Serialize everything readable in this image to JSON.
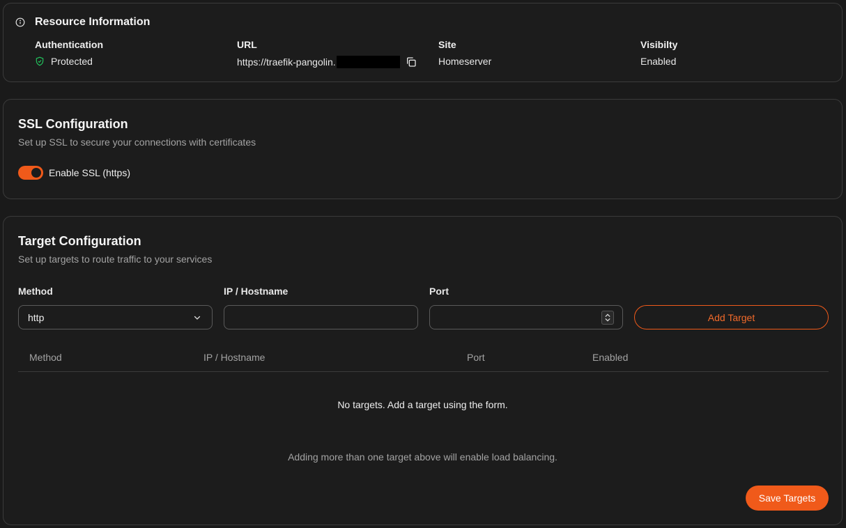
{
  "resource_info": {
    "title": "Resource Information",
    "authentication": {
      "label": "Authentication",
      "value": "Protected"
    },
    "url": {
      "label": "URL",
      "value": "https://traefik-pangolin."
    },
    "site": {
      "label": "Site",
      "value": "Homeserver"
    },
    "visibility": {
      "label": "Visibilty",
      "value": "Enabled"
    }
  },
  "ssl": {
    "title": "SSL Configuration",
    "subtitle": "Set up SSL to secure your connections with certificates",
    "toggle_label": "Enable SSL (https)",
    "enabled": true
  },
  "targets": {
    "title": "Target Configuration",
    "subtitle": "Set up targets to route traffic to your services",
    "form": {
      "method_label": "Method",
      "method_value": "http",
      "ip_label": "IP / Hostname",
      "ip_value": "",
      "port_label": "Port",
      "port_value": "",
      "add_button": "Add Target"
    },
    "table": {
      "columns": [
        "Method",
        "IP / Hostname",
        "Port",
        "Enabled"
      ],
      "empty_message": "No targets. Add a target using the form."
    },
    "load_balancing_note": "Adding more than one target above will enable load balancing.",
    "save_button": "Save Targets"
  },
  "colors": {
    "accent": "#f05a1a",
    "success": "#22c55e",
    "background": "#1a1a1a"
  }
}
